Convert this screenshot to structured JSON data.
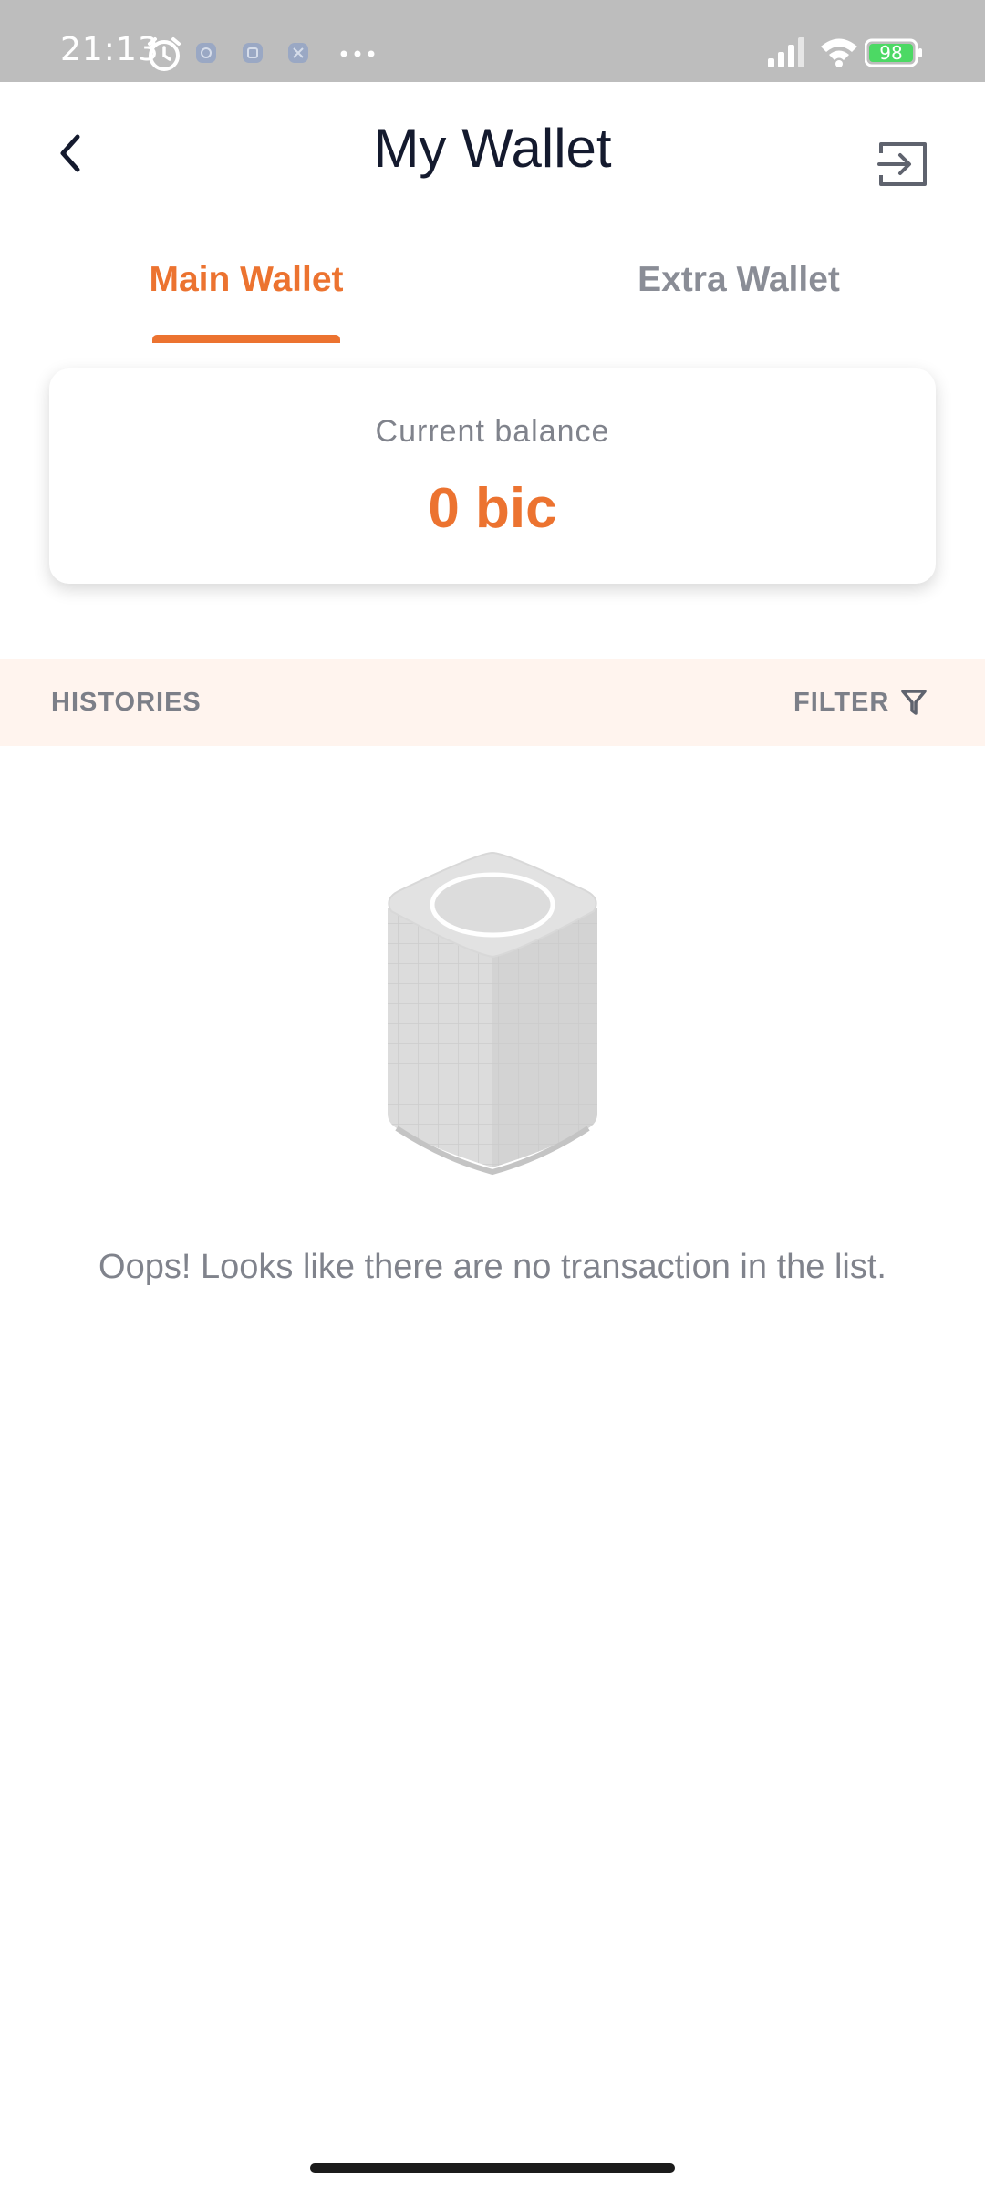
{
  "status_bar": {
    "time": "21:13",
    "battery": "98",
    "icons": [
      "alarm-icon",
      "app-notification-icon",
      "app-notification-icon",
      "app-notification-icon",
      "more-icon",
      "signal-icon",
      "wifi-icon",
      "battery-icon"
    ]
  },
  "header": {
    "title": "My Wallet",
    "back_icon": "chevron-left-icon",
    "action_icon": "logout-icon"
  },
  "tabs": [
    {
      "label": "Main Wallet",
      "active": true
    },
    {
      "label": "Extra Wallet",
      "active": false
    }
  ],
  "balance": {
    "label": "Current balance",
    "value": "0 bic"
  },
  "histories": {
    "label": "HISTORIES",
    "filter_label": "FILTER",
    "filter_icon": "filter-icon"
  },
  "empty_state": {
    "illustration": "empty-box-illustration",
    "message": "Oops! Looks like there are no transaction in the list."
  },
  "colors": {
    "accent": "#ec7330",
    "title": "#141a2e",
    "muted": "#80838c",
    "histories_bg": "#fff4ee",
    "status_bar_bg": "#bdbdbd"
  }
}
